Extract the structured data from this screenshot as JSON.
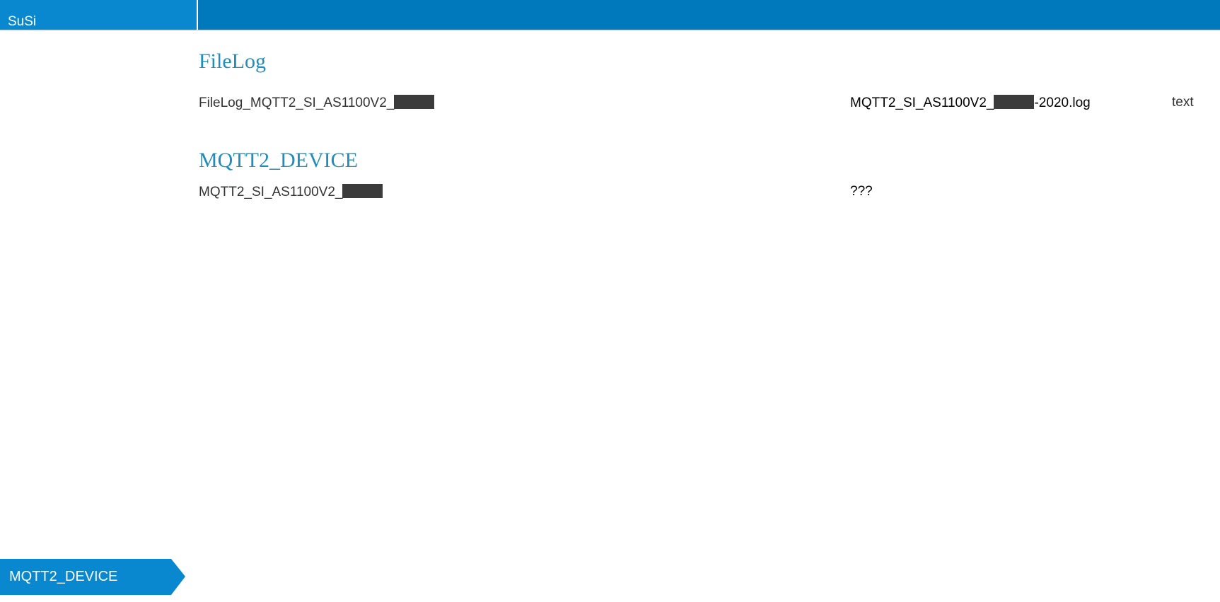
{
  "app": {
    "brand": "SuSi"
  },
  "sections": [
    {
      "title": "FileLog",
      "row": {
        "name_prefix": "FileLog_MQTT2_SI_AS1100V2_",
        "value_prefix": "MQTT2_SI_AS1100V2_",
        "value_suffix": "-2020.log",
        "type": "text"
      }
    },
    {
      "title": "MQTT2_DEVICE",
      "row": {
        "name_prefix": "MQTT2_SI_AS1100V2_",
        "value": "???"
      }
    }
  ],
  "breadcrumb": {
    "current": "MQTT2_DEVICE"
  },
  "colors": {
    "header_bg": "#0079bc",
    "brand_bg": "#0a88cf",
    "section_title": "#1f8dbd",
    "redaction": "#3b3b3b"
  }
}
